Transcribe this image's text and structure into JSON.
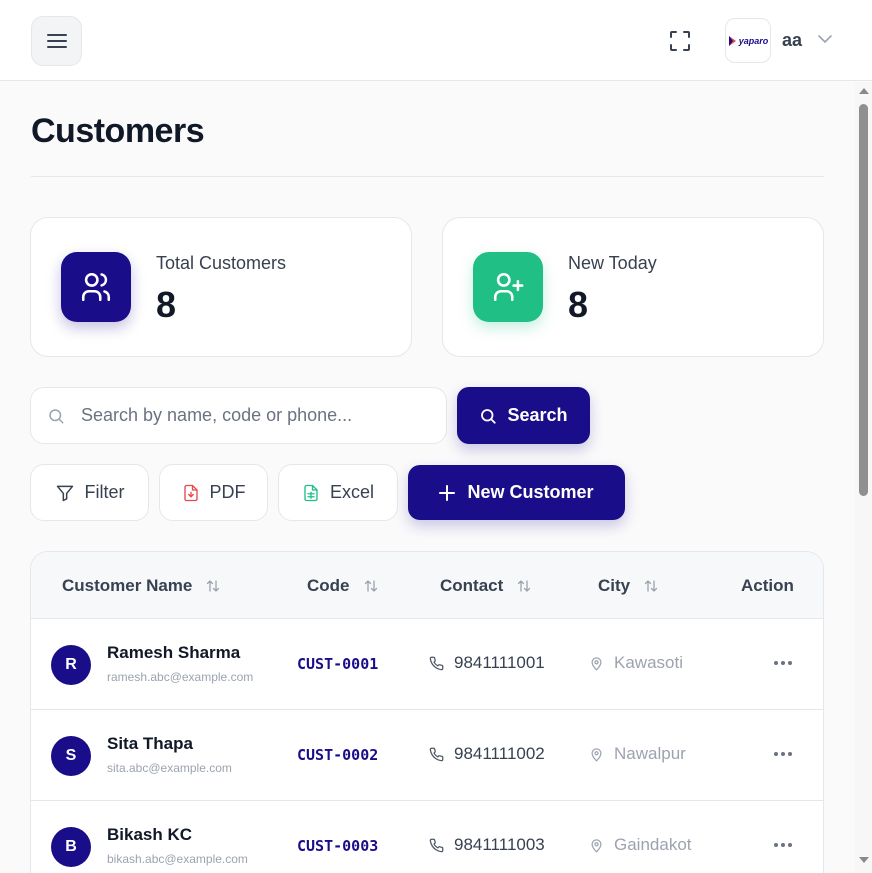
{
  "header": {
    "logo_text": "yaparo",
    "user_name": "aa",
    "icons": [
      "hamburger-menu-icon",
      "fullscreen-icon",
      "chevron-down-icon"
    ]
  },
  "page": {
    "title": "Customers"
  },
  "stats": [
    {
      "label": "Total Customers",
      "value": "8",
      "icon": "users-icon",
      "color": "#1a0d8a"
    },
    {
      "label": "New Today",
      "value": "8",
      "icon": "user-plus-icon",
      "color": "#1fbf86"
    }
  ],
  "search": {
    "placeholder": "Search by name, code or phone...",
    "value": "",
    "button_label": "Search"
  },
  "actions": {
    "filter_label": "Filter",
    "pdf_label": "PDF",
    "excel_label": "Excel",
    "new_label": "New Customer"
  },
  "table": {
    "columns": [
      "Customer Name",
      "Code",
      "Contact",
      "City",
      "Action"
    ],
    "rows": [
      {
        "initial": "R",
        "name": "Ramesh Sharma",
        "email": "ramesh.abc@example.com",
        "code": "CUST-0001",
        "phone": "9841111001",
        "city": "Kawasoti"
      },
      {
        "initial": "S",
        "name": "Sita Thapa",
        "email": "sita.abc@example.com",
        "code": "CUST-0002",
        "phone": "9841111002",
        "city": "Nawalpur"
      },
      {
        "initial": "B",
        "name": "Bikash KC",
        "email": "bikash.abc@example.com",
        "code": "CUST-0003",
        "phone": "9841111003",
        "city": "Gaindakot"
      }
    ]
  },
  "colors": {
    "brand": "#1a0d8a",
    "success": "#1fbf86",
    "pdf": "#e5484d"
  }
}
